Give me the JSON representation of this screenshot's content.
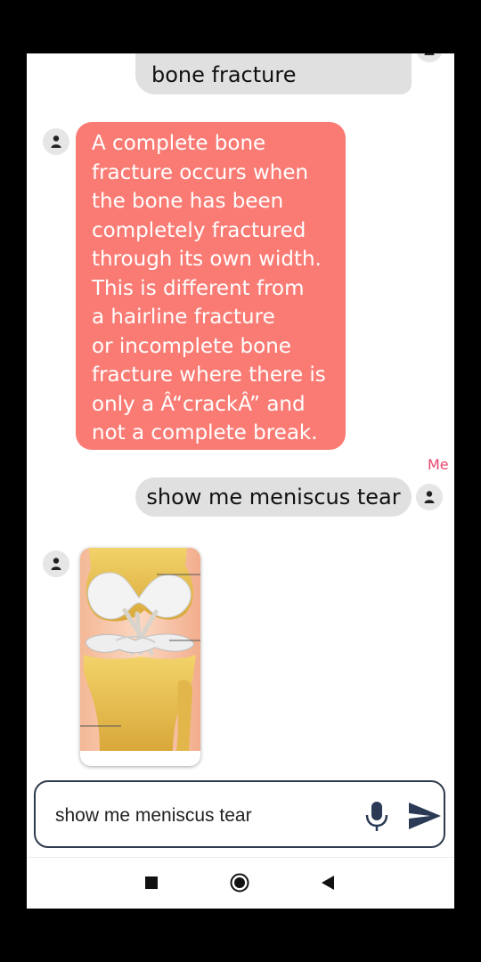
{
  "conversation": {
    "top_user_message": {
      "visible_text": "bone fracture"
    },
    "bot_message_1": {
      "lines": [
        "A complete bone",
        "fracture occurs when",
        "the bone has been",
        "completely fractured",
        "through its own width.",
        "This is different from",
        "a hairline fracture",
        "or incomplete bone",
        "fracture where there is",
        "only a Â“crackÂ” and",
        "not a complete break."
      ]
    },
    "me_label": "Me",
    "user_message_2": "show me meniscus tear",
    "bot_image": {
      "subject": "knee joint anatomy illustration"
    }
  },
  "composer": {
    "value": "show me meniscus tear",
    "mic_icon": "microphone-icon",
    "send_icon": "send-icon"
  },
  "navigation": {
    "recents_icon": "square-recents-icon",
    "home_icon": "circle-home-icon",
    "back_icon": "triangle-back-icon"
  },
  "colors": {
    "bot_bubble": "#fa7b74",
    "user_bubble": "#e0e0e0",
    "me_label": "#e9456d",
    "input_border": "#2f3a4f"
  }
}
